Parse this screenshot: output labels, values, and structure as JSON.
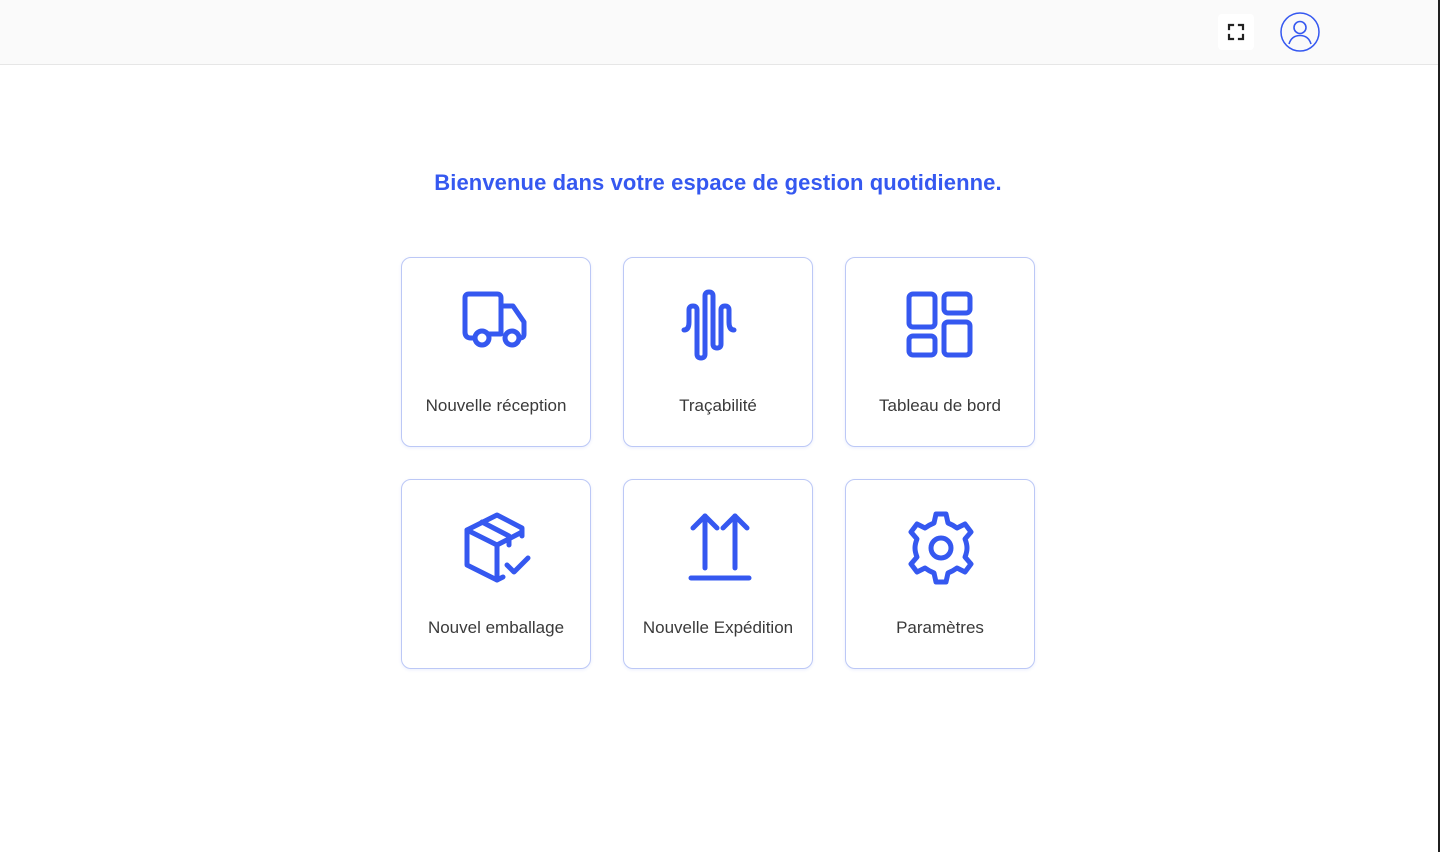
{
  "header": {
    "fullscreen_icon": "fullscreen-icon",
    "avatar_icon": "user-avatar-icon"
  },
  "main": {
    "welcome": "Bienvenue dans votre espace de gestion quotidienne.",
    "tiles": [
      {
        "label": "Nouvelle réception",
        "icon": "truck-icon"
      },
      {
        "label": "Traçabilité",
        "icon": "waveform-icon"
      },
      {
        "label": "Tableau de bord",
        "icon": "dashboard-icon"
      },
      {
        "label": "Nouvel emballage",
        "icon": "package-check-icon"
      },
      {
        "label": "Nouvelle Expédition",
        "icon": "arrows-up-icon"
      },
      {
        "label": "Paramètres",
        "icon": "gear-icon"
      }
    ]
  },
  "colors": {
    "accent": "#3558f0",
    "tile_border": "#bcc8f6",
    "label_text": "#3a3a3a",
    "topbar_bg": "#fafafa"
  }
}
